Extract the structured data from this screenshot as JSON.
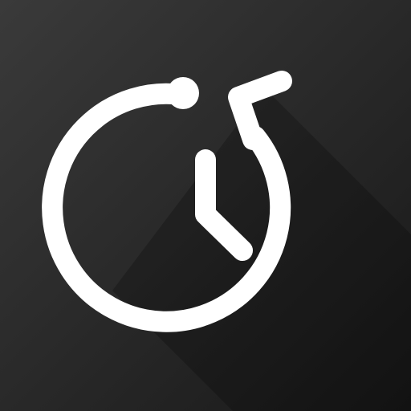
{
  "icon": {
    "name": "clock-history-icon",
    "background_gradient": [
      "#3a3a3a",
      "#181818"
    ],
    "glyph_color": "#ffffff",
    "shadow_color": "#000000"
  }
}
